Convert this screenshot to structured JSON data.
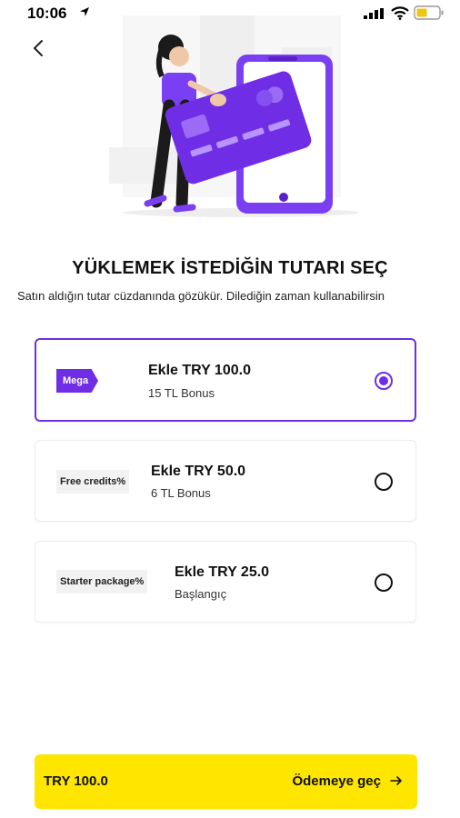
{
  "status_bar": {
    "time": "10:06"
  },
  "header": {
    "title": "YÜKLEMEK İSTEDİĞİN TUTARI SEÇ",
    "subtitle": "Satın aldığın tutar cüzdanında gözükür. Dilediğin zaman kullanabilirsin"
  },
  "options": [
    {
      "badge": "Mega",
      "label": "Ekle TRY 100.0",
      "sub": "15 TL Bonus",
      "selected": true
    },
    {
      "badge": "Free credits%",
      "label": "Ekle TRY 50.0",
      "sub": "6 TL Bonus",
      "selected": false
    },
    {
      "badge": "Starter package%",
      "label": "Ekle TRY 25.0",
      "sub": "Başlangıç",
      "selected": false
    }
  ],
  "footer": {
    "amount": "TRY 100.0",
    "action": "Ödemeye geç"
  },
  "colors": {
    "accent": "#6f2ee5",
    "cta": "#ffe600"
  },
  "icons": [
    "location-arrow-icon",
    "signal-icon",
    "wifi-icon",
    "battery-icon",
    "back-chevron-icon",
    "arrow-right-icon"
  ]
}
